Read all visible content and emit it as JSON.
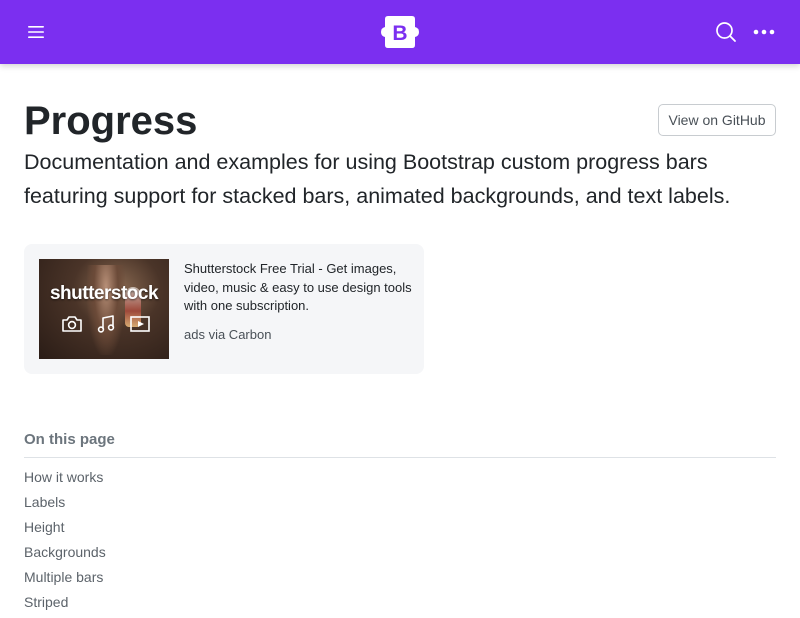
{
  "navbar": {
    "background": "#7b2ff0",
    "menu_icon": "hamburger-menu-icon",
    "brand_logo": "bootstrap-logo-icon",
    "brand_letter": "B",
    "search_icon": "search-icon",
    "more_icon": "more-horizontal-icon"
  },
  "header": {
    "title": "Progress",
    "github_button": "View on GitHub",
    "lead": "Documentation and examples for using Bootstrap custom progress bars featuring support for stacked bars, animated backgrounds, and text labels."
  },
  "ad": {
    "brand": "shutterstock",
    "icons": [
      "camera-icon",
      "music-note-icon",
      "video-play-icon"
    ],
    "text": "Shutterstock Free Trial - Get images, video, music & easy to use design tools with one subscription.",
    "via": "ads via Carbon"
  },
  "toc": {
    "heading": "On this page",
    "items": [
      {
        "label": "How it works"
      },
      {
        "label": "Labels"
      },
      {
        "label": "Height"
      },
      {
        "label": "Backgrounds"
      },
      {
        "label": "Multiple bars"
      },
      {
        "label": "Striped"
      }
    ]
  }
}
